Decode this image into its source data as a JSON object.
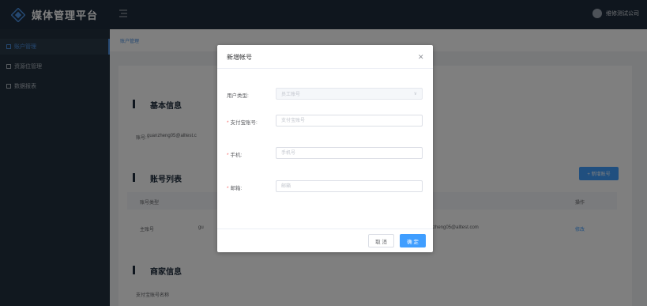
{
  "app": {
    "title": "媒体管理平台",
    "user": "维修测试公司"
  },
  "sidebar": {
    "items": [
      {
        "label": "账户管理"
      },
      {
        "label": "资源位管理"
      },
      {
        "label": "数据报表"
      }
    ]
  },
  "breadcrumb": "账户管理",
  "page": {
    "basic_info_title": "基本信息",
    "account_label": "账号:",
    "account_value": "guanzheng05@alltest.c",
    "account_list_title": "账号列表",
    "add_account_button": "+ 新增账号",
    "table_headers": [
      "账号类型",
      "操作"
    ],
    "row": {
      "type": "主账号",
      "email": "guanzheng05@alltest.com",
      "email_visible": "zheng05@alltest.com",
      "name_partial": "gu",
      "action": "修改"
    },
    "merchant_info_title": "商家信息",
    "merchant_field": "支付宝账号名称"
  },
  "modal": {
    "title": "新增帐号",
    "fields": {
      "user_type": {
        "label": "用户类型:",
        "placeholder": "员工账号"
      },
      "alipay": {
        "label": "支付宝账号:",
        "placeholder": "支付宝账号",
        "required": "*"
      },
      "phone": {
        "label": "手机:",
        "placeholder": "手机号",
        "required": "*"
      },
      "email": {
        "label": "邮箱:",
        "placeholder": "邮箱",
        "required": "*"
      }
    },
    "cancel": "取 消",
    "ok": "确 定"
  }
}
